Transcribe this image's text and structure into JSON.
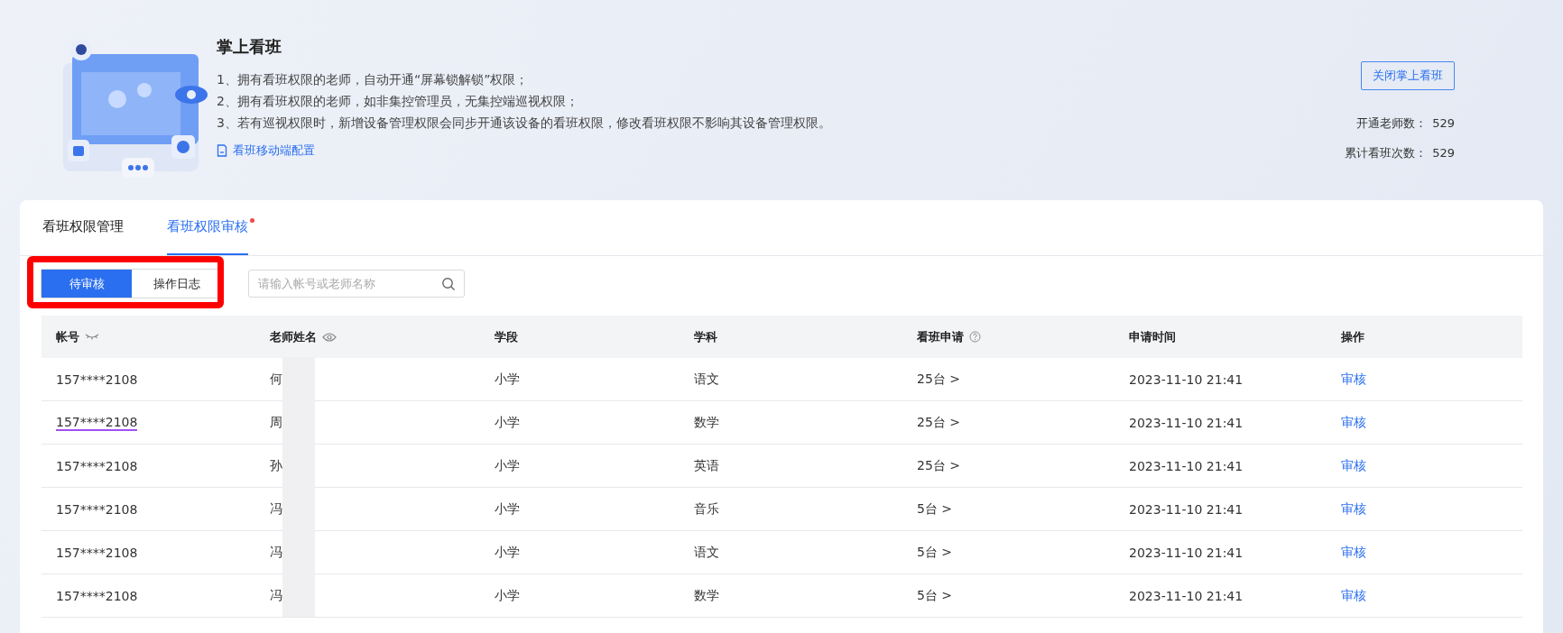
{
  "banner": {
    "title": "掌上看班",
    "notes": [
      "1、拥有看班权限的老师，自动开通“屏幕锁解锁”权限；",
      "2、拥有看班权限的老师，如非集控管理员，无集控端巡视权限；",
      "3、若有巡视权限时，新增设备管理权限会同步开通该设备的看班权限，修改看班权限不影响其设备管理权限。"
    ],
    "link": "看班移动端配置",
    "button": "关闭掌上看班",
    "stats": [
      {
        "label": "开通老师数：",
        "value": "529"
      },
      {
        "label": "累计看班次数：",
        "value": "529"
      }
    ]
  },
  "tabs": [
    {
      "label": "看班权限管理",
      "selected": false,
      "badge": false
    },
    {
      "label": "看班权限审核",
      "selected": true,
      "badge": true
    }
  ],
  "segments": [
    {
      "label": "待审核",
      "selected": true
    },
    {
      "label": "操作日志",
      "selected": false
    }
  ],
  "search": {
    "placeholder": "请输入帐号或老师名称"
  },
  "table": {
    "columns": [
      {
        "label": "帐号",
        "kind": "masked"
      },
      {
        "label": "老师姓名",
        "kind": "revealable"
      },
      {
        "label": "学段",
        "kind": "plain"
      },
      {
        "label": "学科",
        "kind": "plain"
      },
      {
        "label": "看班申请",
        "kind": "hinted"
      },
      {
        "label": "申请时间"
      },
      {
        "label": "操作"
      }
    ],
    "rows": [
      {
        "account": "157****2108",
        "underlined": false,
        "name": "何",
        "stage": "小学",
        "subject": "语文",
        "devices": "25台 >",
        "time": "2023-11-10 21:41",
        "action": "审核"
      },
      {
        "account": "157****2108",
        "underlined": true,
        "name": "周",
        "stage": "小学",
        "subject": "数学",
        "devices": "25台 >",
        "time": "2023-11-10 21:41",
        "action": "审核"
      },
      {
        "account": "157****2108",
        "underlined": false,
        "name": "孙",
        "stage": "小学",
        "subject": "英语",
        "devices": "25台 >",
        "time": "2023-11-10 21:41",
        "action": "审核"
      },
      {
        "account": "157****2108",
        "underlined": false,
        "name": "冯",
        "stage": "小学",
        "subject": "音乐",
        "devices": "5台 >",
        "time": "2023-11-10 21:41",
        "action": "审核"
      },
      {
        "account": "157****2108",
        "underlined": false,
        "name": "冯",
        "stage": "小学",
        "subject": "语文",
        "devices": "5台 >",
        "time": "2023-11-10 21:41",
        "action": "审核"
      },
      {
        "account": "157****2108",
        "underlined": false,
        "name": "冯",
        "stage": "小学",
        "subject": "数学",
        "devices": "5台 >",
        "time": "2023-11-10 21:41",
        "action": "审核"
      }
    ]
  }
}
